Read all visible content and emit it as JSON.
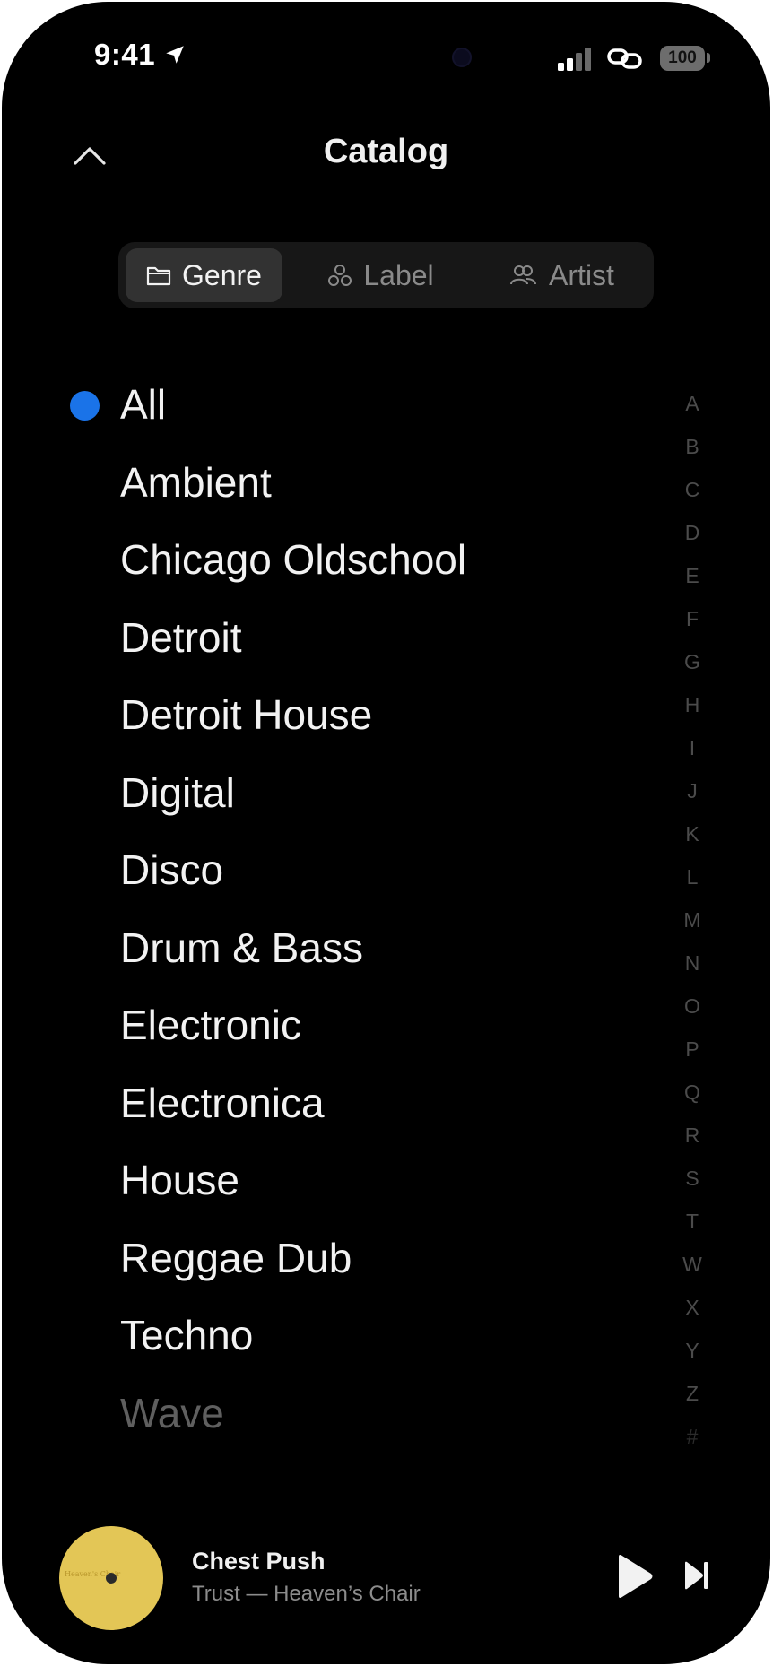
{
  "status_bar": {
    "time": "9:41",
    "battery": "100"
  },
  "header": {
    "title": "Catalog"
  },
  "tabs": [
    {
      "label": "Genre",
      "icon": "folder-icon",
      "active": true
    },
    {
      "label": "Label",
      "icon": "label-icon",
      "active": false
    },
    {
      "label": "Artist",
      "icon": "artists-icon",
      "active": false
    }
  ],
  "genres": [
    "All",
    "Ambient",
    "Chicago Oldschool",
    "Detroit",
    "Detroit House",
    "Digital",
    "Disco",
    "Drum & Bass",
    "Electronic",
    "Electronica",
    "House",
    "Reggae Dub",
    "Techno",
    "Wave"
  ],
  "selected_genre": "All",
  "index_letters": [
    "A",
    "B",
    "C",
    "D",
    "E",
    "F",
    "G",
    "H",
    "I",
    "J",
    "K",
    "L",
    "M",
    "N",
    "O",
    "P",
    "Q",
    "R",
    "S",
    "T",
    "W",
    "X",
    "Y",
    "Z",
    "#"
  ],
  "now_playing": {
    "title": "Chest Push",
    "subtitle": "Trust — Heaven’s Chair",
    "art_color": "#e3c656"
  },
  "colors": {
    "accent": "#1a73e8",
    "background": "#000000"
  }
}
